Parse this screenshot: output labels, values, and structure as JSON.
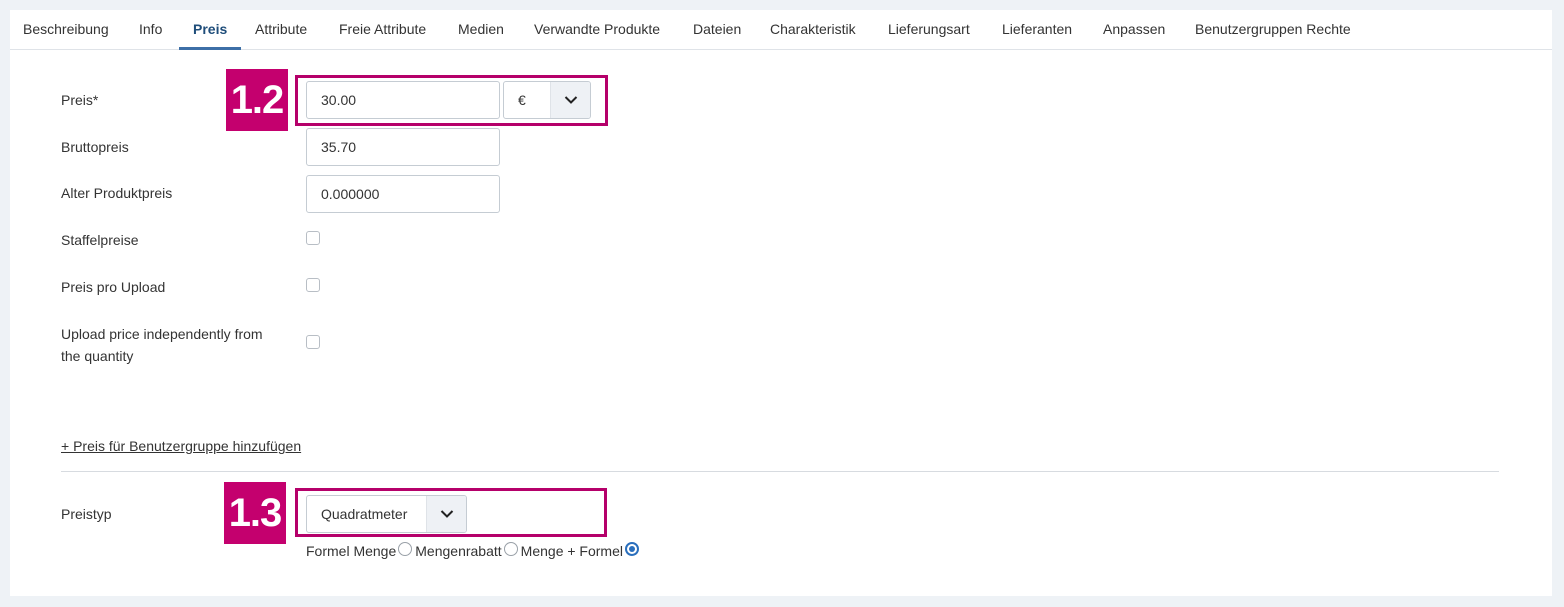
{
  "tabs": [
    {
      "label": "Beschreibung"
    },
    {
      "label": "Info"
    },
    {
      "label": "Preis"
    },
    {
      "label": "Attribute"
    },
    {
      "label": "Freie Attribute"
    },
    {
      "label": "Medien"
    },
    {
      "label": "Verwandte Produkte"
    },
    {
      "label": "Dateien"
    },
    {
      "label": "Charakteristik"
    },
    {
      "label": "Lieferungsart"
    },
    {
      "label": "Lieferanten"
    },
    {
      "label": "Anpassen"
    },
    {
      "label": "Benutzergruppen Rechte"
    }
  ],
  "active_tab": "Preis",
  "form": {
    "price_label": "Preis*",
    "price_value": "30.00",
    "currency_value": "€",
    "gross_label": "Bruttopreis",
    "gross_value": "35.70",
    "old_price_label": "Alter Produktpreis",
    "old_price_value": "0.000000",
    "tiered_label": "Staffelpreise",
    "upload_price_label": "Preis pro Upload",
    "upload_independent_label_line1": "Upload price independently from",
    "upload_independent_label_line2": "the quantity",
    "add_group_price_link": "+ Preis für Benutzergruppe hinzufügen",
    "price_type_label": "Preistyp",
    "price_type_value": "Quadratmeter",
    "radio_options": [
      {
        "label": "Formel Menge",
        "checked": false
      },
      {
        "label": "Mengenrabatt",
        "checked": false
      },
      {
        "label": "Menge + Formel",
        "checked": true
      }
    ]
  },
  "annotations": {
    "badge_1": "1.2",
    "badge_2": "1.3",
    "color": "#c4006e"
  },
  "colors": {
    "active_tab": "#3d6fa7",
    "radio_checked": "#2a6fbd"
  }
}
